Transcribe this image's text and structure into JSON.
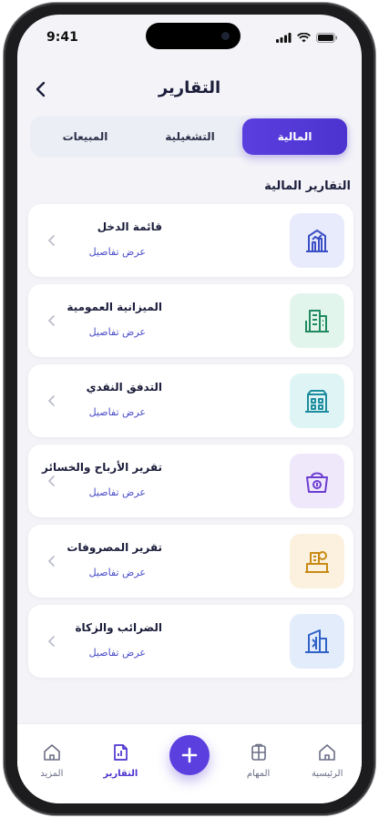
{
  "status_bar": {
    "time": "9:41"
  },
  "header": {
    "title": "التقارير"
  },
  "tabs": [
    {
      "label": "المالية",
      "active": true
    },
    {
      "label": "التشغيلية",
      "active": false
    },
    {
      "label": "المبيعات",
      "active": false
    }
  ],
  "section_title": "التقارير المالية",
  "reports": [
    {
      "name": "قائمة الدخل",
      "link": "عرض تفاصيل",
      "icon": "building-chart-icon",
      "color": "#3b4fc4",
      "bg": "#e8ebfb"
    },
    {
      "name": "الميزانية العمومية",
      "link": "عرض تفاصيل",
      "icon": "balance-sheet-icon",
      "color": "#1f8a62",
      "bg": "#e2f5ec"
    },
    {
      "name": "التدفق النقدي",
      "link": "عرض تفاصيل",
      "icon": "cash-flow-icon",
      "color": "#1c8d9e",
      "bg": "#dff4f5"
    },
    {
      "name": "تقرير الأرباح والخسائر",
      "link": "عرض تفاصيل",
      "icon": "profit-loss-icon",
      "color": "#6c3dd1",
      "bg": "#efe8fb"
    },
    {
      "name": "تقرير المصروفات",
      "link": "عرض تفاصيل",
      "icon": "expenses-icon",
      "color": "#c98a14",
      "bg": "#fcf1df"
    },
    {
      "name": "الضرائب والزكاة",
      "link": "عرض تفاصيل",
      "icon": "tax-icon",
      "color": "#2f63c8",
      "bg": "#e3ecfb"
    }
  ],
  "bottom_nav": [
    {
      "label": "المزيد",
      "icon": "home-outline-icon",
      "active": false
    },
    {
      "label": "التقارير",
      "icon": "reports-icon",
      "active": true
    },
    {
      "label": "",
      "icon": "plus-icon",
      "fab": true
    },
    {
      "label": "المهام",
      "icon": "tasks-icon",
      "active": false
    },
    {
      "label": "الرئيسية",
      "icon": "home-icon",
      "active": false
    }
  ]
}
